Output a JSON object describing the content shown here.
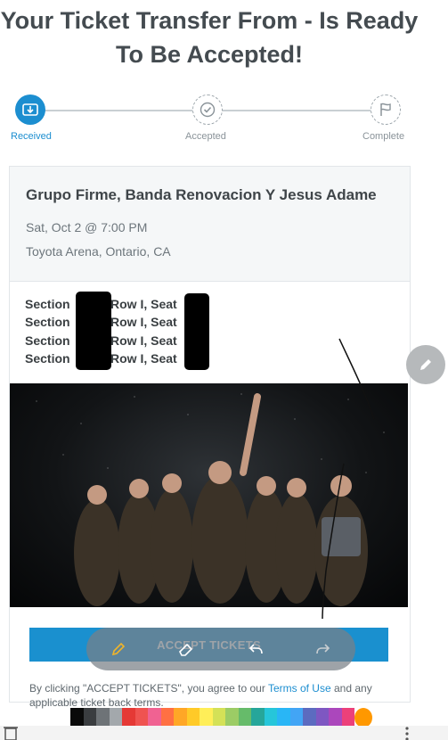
{
  "page": {
    "title": "Your Ticket Transfer From - Is Ready To Be Accepted!"
  },
  "steps": [
    {
      "label": "Received",
      "icon": "ticket-icon",
      "active": true
    },
    {
      "label": "Accepted",
      "icon": "check-icon",
      "active": false
    },
    {
      "label": "Complete",
      "icon": "flag-icon",
      "active": false
    }
  ],
  "event": {
    "name": "Grupo Firme, Banda Renovacion Y Jesus Adame",
    "date": "Sat, Oct 2 @ 7:00 PM",
    "venue": "Toyota Arena, Ontario, CA"
  },
  "seats": [
    {
      "section": "Section",
      "row_seat": "Row I, Seat"
    },
    {
      "section": "Section",
      "row_seat": "Row I, Seat"
    },
    {
      "section": "Section",
      "row_seat": "Row I, Seat"
    },
    {
      "section": "Section",
      "row_seat": "Row I, Seat"
    }
  ],
  "accept_button": "ACCEPT TICKETS",
  "terms": {
    "prefix": "By clicking \"ACCEPT TICKETS\", you agree to our ",
    "link": "Terms of Use",
    "suffix": " and any applicable ticket back terms."
  },
  "draw_tools": [
    "pencil-icon",
    "eraser-icon",
    "undo-icon",
    "redo-icon"
  ],
  "palette": [
    "#0a0a0a",
    "#3a3d40",
    "#6e7377",
    "#a3a8ac",
    "#e53935",
    "#ef5350",
    "#f06292",
    "#ff7043",
    "#ffa726",
    "#ffca28",
    "#ffee58",
    "#d4e157",
    "#9ccc65",
    "#66bb6a",
    "#26a69a",
    "#26c6da",
    "#29b6f6",
    "#42a5f5",
    "#5c6bc0",
    "#7e57c2",
    "#ab47bc",
    "#ec407a",
    "#ff9800"
  ],
  "colors": {
    "accent": "#1c8ed0",
    "title": "#444b50"
  }
}
